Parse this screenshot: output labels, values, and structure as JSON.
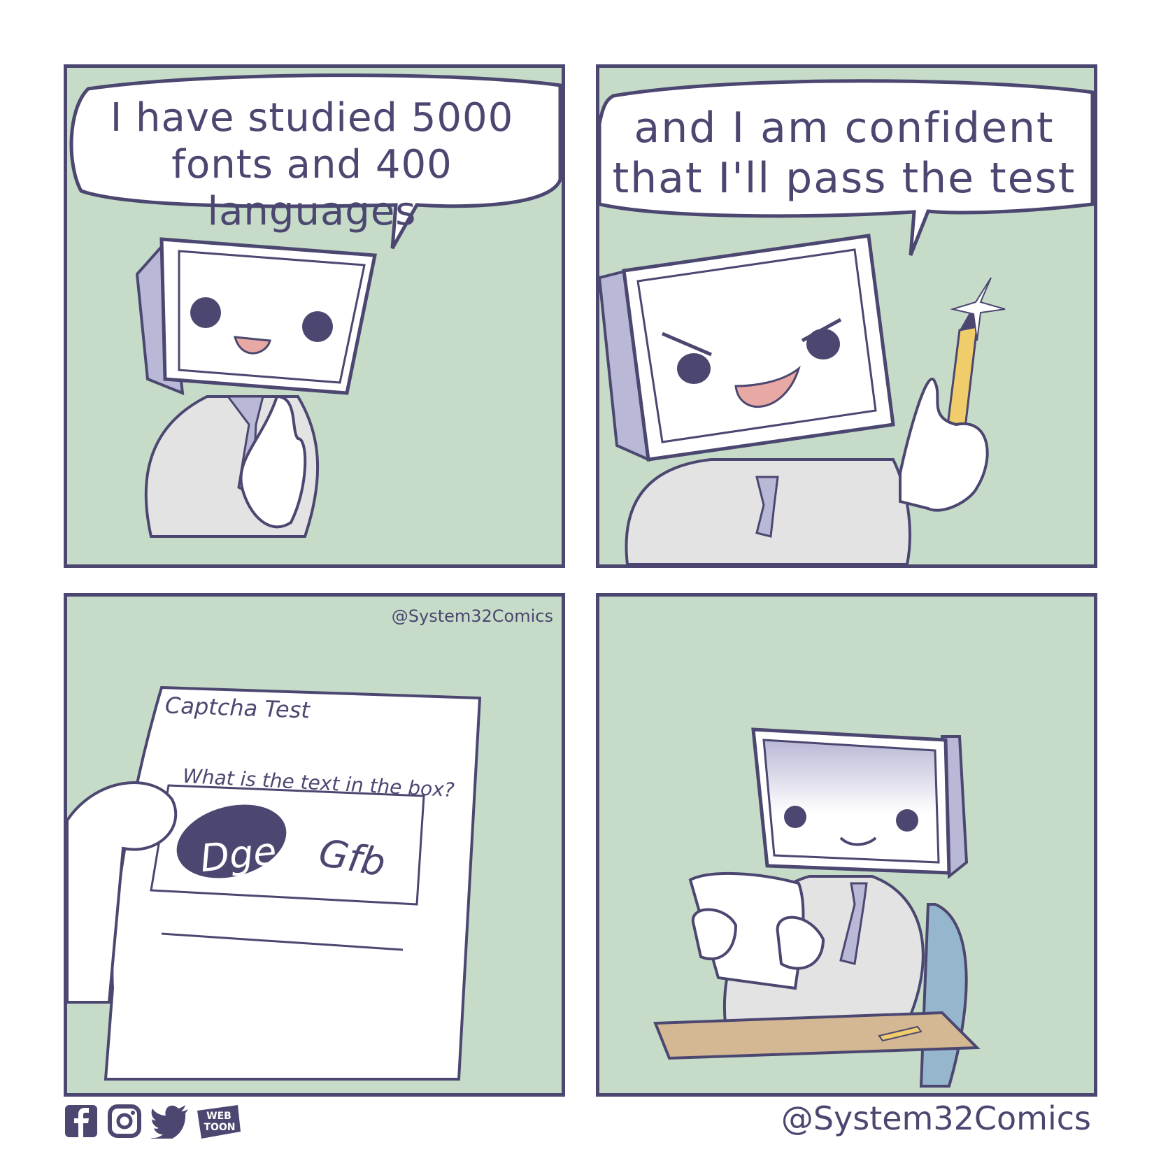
{
  "panels": [
    {
      "speech": [
        "I have studied 5000",
        "fonts and 400 languages"
      ]
    },
    {
      "speech": [
        "and I am confident",
        "that I'll pass the test"
      ]
    },
    {
      "watermark": "@System32Comics",
      "paper": {
        "title": "Captcha Test",
        "question": "What is the text in the box?",
        "captcha_covered": "Dge 2",
        "captcha_visible": "Gfb"
      }
    },
    {}
  ],
  "footer": {
    "handle": "@System32Comics",
    "icons": [
      "facebook-icon",
      "instagram-icon",
      "twitter-icon",
      "webtoon-icon"
    ],
    "webtoon_label_top": "WEB",
    "webtoon_label_bottom": "TOON"
  },
  "colors": {
    "ink": "#4b4770",
    "panel_bg": "#c6dcc8",
    "monitor": "#b9b8d6",
    "suit": "#e3e3e3",
    "tongue": "#e8a9a4",
    "pencil": "#f0cc6a",
    "desk": "#d4b894",
    "chair": "#95b6cc"
  }
}
